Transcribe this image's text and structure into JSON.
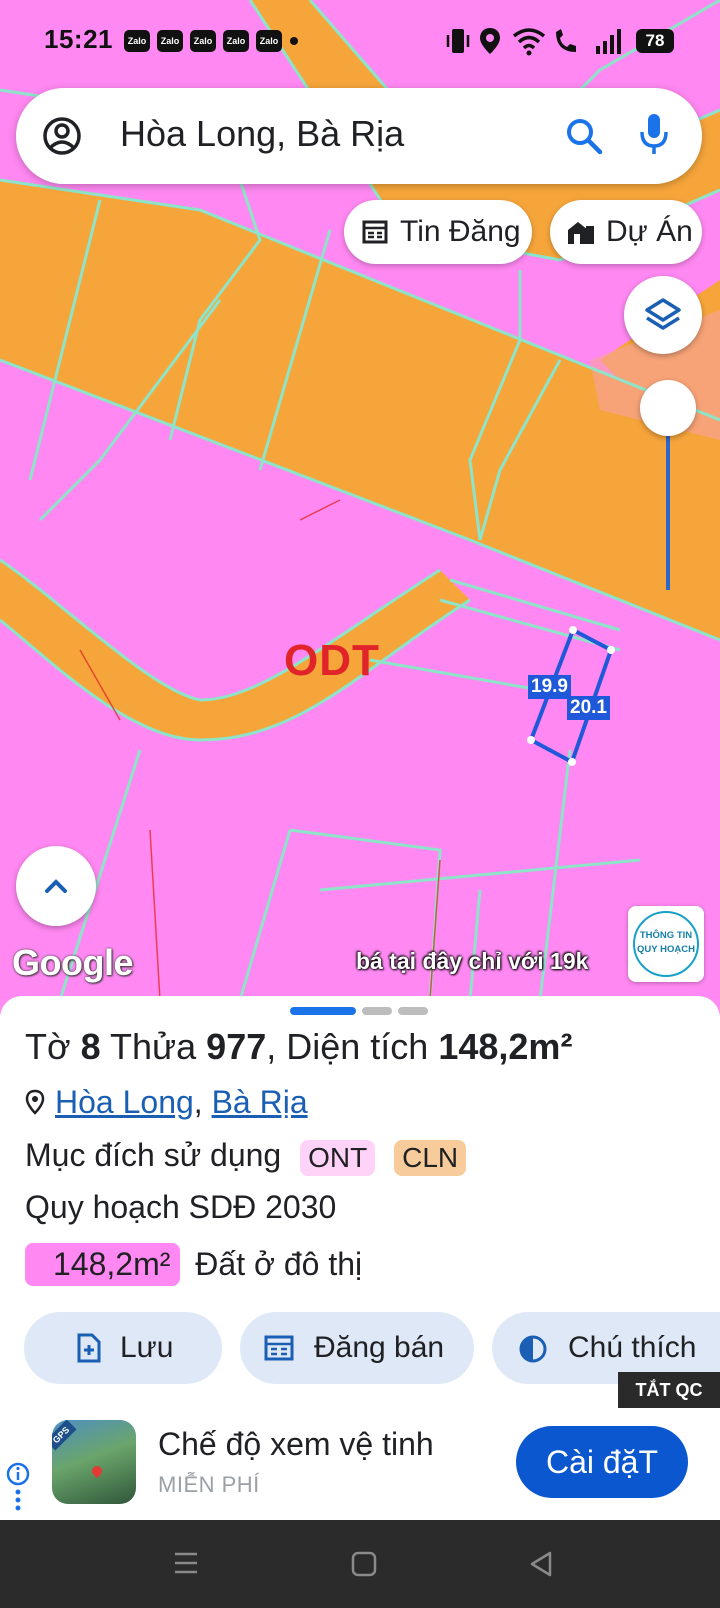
{
  "status_bar": {
    "time": "15:21",
    "notification_icons": [
      "Zalo",
      "Zalo",
      "Zalo",
      "Zalo",
      "Zalo"
    ],
    "battery": "78"
  },
  "search": {
    "query": "Hòa Long, Bà Rịa"
  },
  "chips": [
    {
      "label": "Tin Đăng",
      "icon": "listing-icon"
    },
    {
      "label": "Dự Án",
      "icon": "buildings-icon"
    }
  ],
  "map": {
    "zone_label": "ODT",
    "edge_labels": [
      "19.9",
      "20.1"
    ],
    "google_text": "Google",
    "promo_text": "bá tại đây chỉ với 19k",
    "logo_lines": [
      "THÔNG TIN",
      "QUY HOẠCH"
    ],
    "colors": {
      "residential": "#ff88f2",
      "road": "#f6a53b",
      "boundary": "#8ee4c8",
      "selected": "#1f58d8"
    }
  },
  "parcel": {
    "to_label": "Tờ",
    "to_value": "8",
    "thua_label": "Thửa",
    "thua_value": "977",
    "dien_tich_label": ", Diện tích",
    "area": "148,2m²",
    "location_parts": [
      "Hòa Long",
      "Bà Rịa"
    ],
    "purpose_label": "Mục đích sử dụng",
    "purpose_badges": [
      {
        "code": "ONT",
        "color": "#ffd3f7"
      },
      {
        "code": "CLN",
        "color": "#f8cc9a"
      }
    ],
    "plan_label": "Quy hoạch SDĐ 2030",
    "plan_area": "148,2m²",
    "plan_type": "Đất ở đô thị"
  },
  "actions": [
    {
      "label": "Lưu",
      "icon": "save-file-icon"
    },
    {
      "label": "Đăng bán",
      "icon": "post-sale-icon"
    },
    {
      "label": "Chú thích",
      "icon": "legend-contrast-icon"
    }
  ],
  "ad": {
    "close_label": "TẮT QC",
    "title": "Chế độ xem vệ tinh",
    "subtitle": "MIỄN PHÍ",
    "cta": "Cài đặT"
  }
}
